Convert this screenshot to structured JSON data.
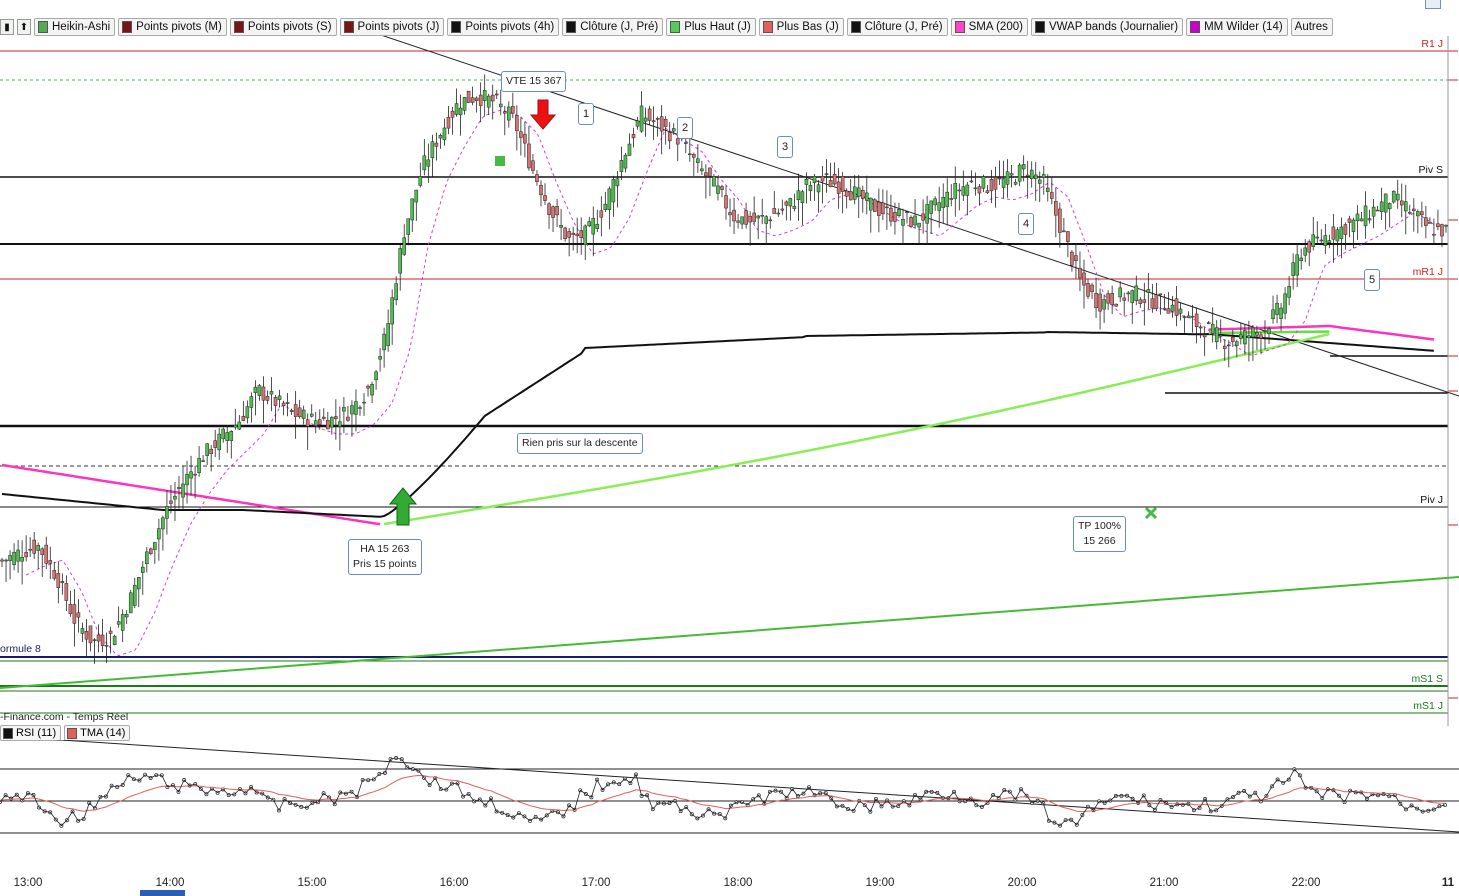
{
  "toolbar": {
    "items": [
      {
        "label": "Heikin-Ashi",
        "color": "#55aa55"
      },
      {
        "label": "Points pivots (M)",
        "color": "#7a1414"
      },
      {
        "label": "Points pivots (S)",
        "color": "#7a1414"
      },
      {
        "label": "Points pivots (J)",
        "color": "#7a1414"
      },
      {
        "label": "Points pivots (4h)",
        "color": "#111111"
      },
      {
        "label": "Clôture (J, Pré)",
        "color": "#111111"
      },
      {
        "label": "Plus Haut (J)",
        "color": "#55cc55"
      },
      {
        "label": "Plus Bas (J)",
        "color": "#e06060"
      },
      {
        "label": "Clôture (J, Pré)",
        "color": "#111111"
      },
      {
        "label": "SMA (200)",
        "color": "#ff44cc"
      },
      {
        "label": "VWAP bands (Journalier)",
        "color": "#111111"
      },
      {
        "label": "MM Wilder (14)",
        "color": "#cc00cc"
      },
      {
        "label": "Autres",
        "color": ""
      }
    ]
  },
  "levels": [
    {
      "label": "R1 J",
      "color": "#cc2222"
    },
    {
      "label": "Piv S",
      "color": "#111111"
    },
    {
      "label": "mR1 J",
      "color": "#cc2222"
    },
    {
      "label": "Piv J",
      "color": "#111111"
    },
    {
      "label": "mS1 S",
      "color": "#1a7a1a"
    },
    {
      "label": "mS1 J",
      "color": "#1a7a1a"
    }
  ],
  "annotations": {
    "vte": "VTE 15 367",
    "ha_line1": "HA 15 263",
    "ha_line2": "Pris 15 points",
    "rien": "Rien pris sur la descente",
    "tp_line1": "TP  100%",
    "tp_line2": "15 266",
    "numbers": [
      "1",
      "2",
      "3",
      "4",
      "5"
    ]
  },
  "source_text": "-Finance.com - Temps Réel",
  "formule_text": "ormule 8",
  "rsi_legend": [
    {
      "label": "RSI (11)",
      "color": "#111111"
    },
    {
      "label": "TMA (14)",
      "color": "#e06060"
    }
  ],
  "chart_data": {
    "type": "candlestick",
    "xlabel": "",
    "ylabel": "",
    "x_ticks": [
      "13:00",
      "14:00",
      "15:00",
      "16:00",
      "17:00",
      "18:00",
      "19:00",
      "20:00",
      "21:00",
      "22:00",
      "11"
    ],
    "series": [
      {
        "name": "Heikin-Ashi",
        "type": "candlestick",
        "close_path": [
          15205,
          15208,
          15210,
          15200,
          15185,
          15178,
          15180,
          15192,
          15208,
          15222,
          15232,
          15240,
          15246,
          15252,
          15262,
          15258,
          15254,
          15252,
          15252,
          15255,
          15262,
          15280,
          15315,
          15336,
          15348,
          15358,
          15360,
          15358,
          15352,
          15336,
          15322,
          15312,
          15314,
          15324,
          15340,
          15354,
          15350,
          15346,
          15337,
          15330,
          15320,
          15318,
          15320,
          15323,
          15330,
          15332,
          15330,
          15326,
          15322,
          15320,
          15318,
          15323,
          15328,
          15331,
          15330,
          15332,
          15336,
          15331,
          15315,
          15298,
          15291,
          15293,
          15294,
          15292,
          15290,
          15285,
          15282,
          15278,
          15280,
          15282,
          15290,
          15308,
          15312,
          15315,
          15318,
          15322,
          15326,
          15322,
          15316,
          15315
        ]
      },
      {
        "name": "SMA (200)",
        "type": "line"
      },
      {
        "name": "VWAP bands (Journalier)",
        "type": "line"
      },
      {
        "name": "MM Wilder (14)",
        "type": "line"
      },
      {
        "name": "RSI (11)",
        "type": "line",
        "panel": "rsi"
      },
      {
        "name": "TMA (14)",
        "type": "line",
        "panel": "rsi"
      }
    ]
  }
}
